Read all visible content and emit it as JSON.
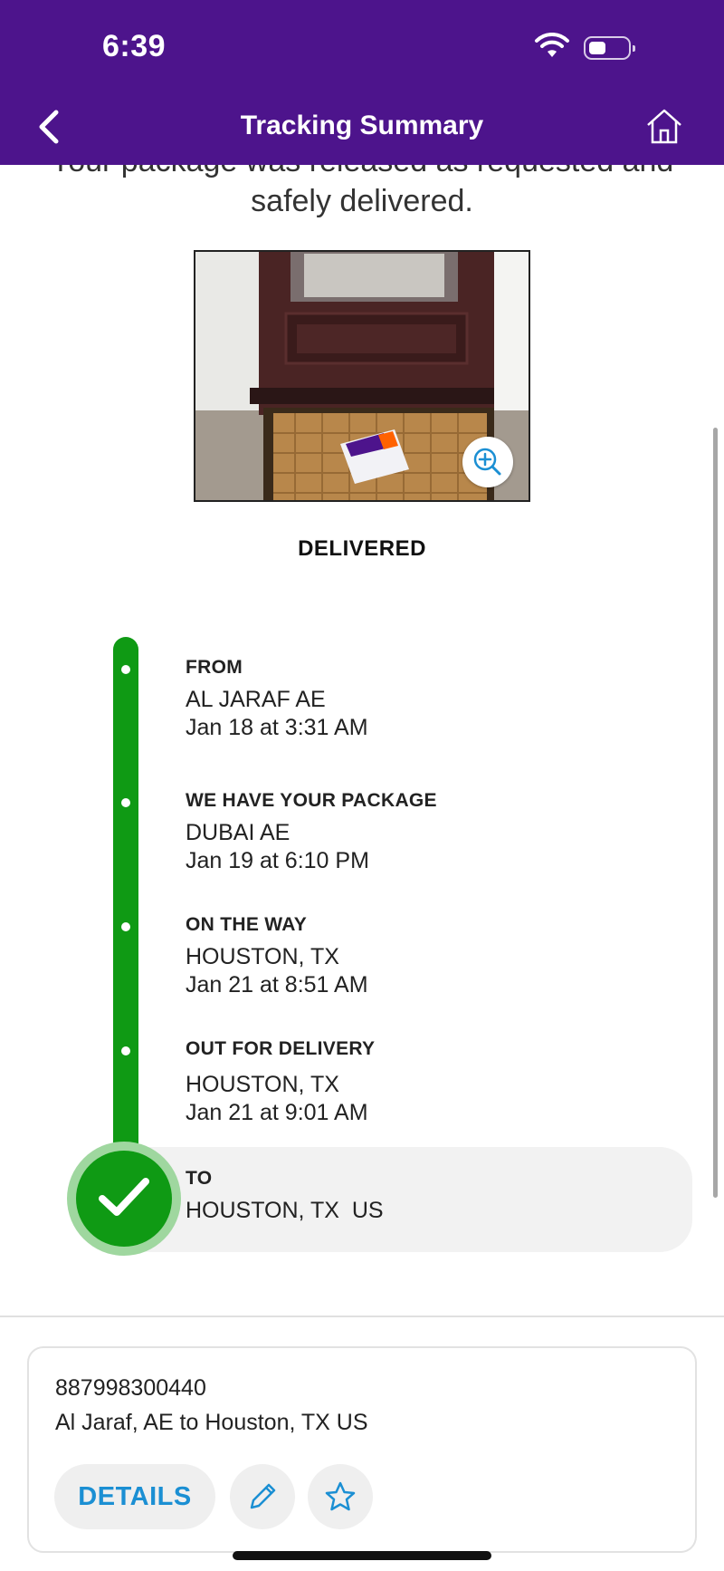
{
  "status": {
    "time": "6:39"
  },
  "nav": {
    "title": "Tracking Summary"
  },
  "message": "Your package was released as requested and safely delivered.",
  "status_label": "DELIVERED",
  "events": [
    {
      "label": "FROM",
      "location": "AL JARAF AE",
      "time": "Jan 18 at 3:31 AM"
    },
    {
      "label": "WE HAVE YOUR PACKAGE",
      "location": "DUBAI AE",
      "time": "Jan 19 at 6:10 PM"
    },
    {
      "label": "ON THE WAY",
      "location": "HOUSTON, TX",
      "time": "Jan 21 at 8:51 AM"
    },
    {
      "label": "OUT FOR DELIVERY",
      "location": "HOUSTON, TX",
      "time": "Jan 21 at 9:01 AM"
    },
    {
      "label": "TO",
      "location": "HOUSTON, TX  US"
    }
  ],
  "card": {
    "tracking_number": "887998300440",
    "route": "Al Jaraf, AE to Houston, TX US",
    "details_label": "DETAILS"
  },
  "colors": {
    "brand_purple": "#4d148c",
    "progress_green": "#0f9a14",
    "link_blue": "#1b8fd3"
  },
  "icons": [
    "back-chevron-icon",
    "home-icon",
    "zoom-in-icon",
    "checkmark-icon",
    "pencil-icon",
    "star-icon",
    "wifi-icon",
    "battery-icon"
  ]
}
